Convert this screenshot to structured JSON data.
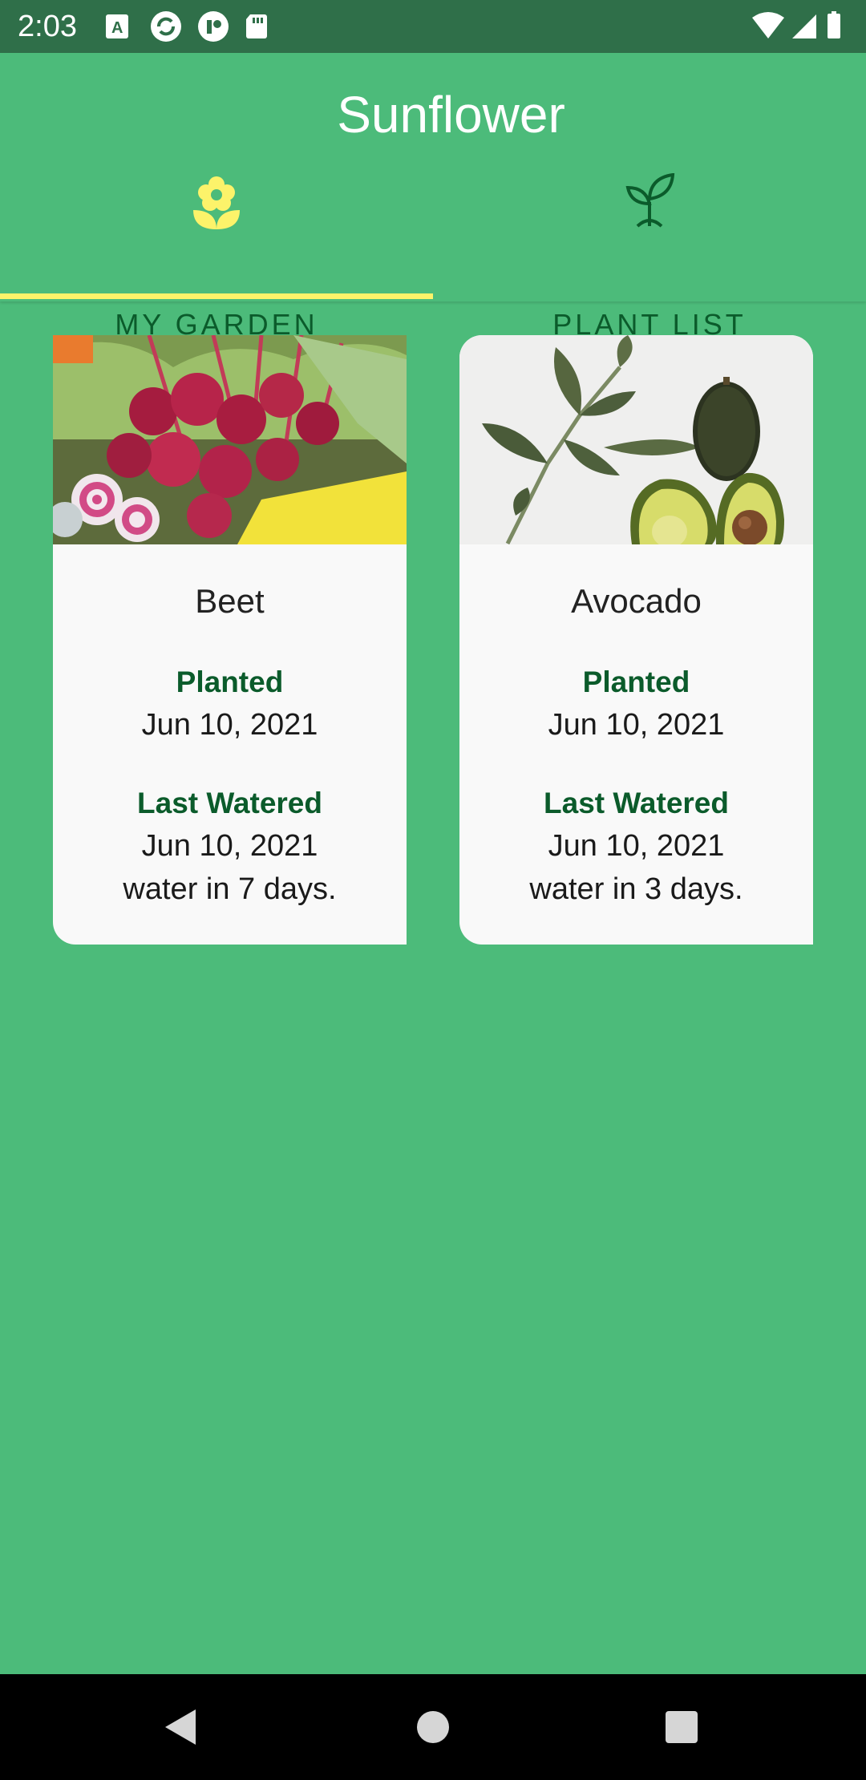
{
  "status_bar": {
    "time": "2:03",
    "left_icons": [
      "text-a-icon",
      "sync-icon",
      "pocket-icon",
      "sd-card-icon"
    ],
    "right_icons": [
      "wifi-icon",
      "signal-icon",
      "battery-icon"
    ]
  },
  "app": {
    "title": "Sunflower",
    "accent_color": "#fcf36a",
    "background_color": "#4cbb7a",
    "label_color": "#0b5b2b"
  },
  "tabs": [
    {
      "label": "MY GARDEN",
      "icon": "flower-icon",
      "selected": true
    },
    {
      "label": "PLANT LIST",
      "icon": "sprout-icon",
      "selected": false
    }
  ],
  "garden": [
    {
      "name": "Beet",
      "image": "beet-photo",
      "planted_label": "Planted",
      "planted_date": "Jun 10, 2021",
      "watered_label": "Last Watered",
      "watered_date": "Jun 10, 2021",
      "water_in": "water in 7 days."
    },
    {
      "name": "Avocado",
      "image": "avocado-photo",
      "planted_label": "Planted",
      "planted_date": "Jun 10, 2021",
      "watered_label": "Last Watered",
      "watered_date": "Jun 10, 2021",
      "water_in": "water in 3 days."
    }
  ],
  "nav_bar": {
    "buttons": [
      "back-icon",
      "home-icon",
      "recents-icon"
    ]
  }
}
